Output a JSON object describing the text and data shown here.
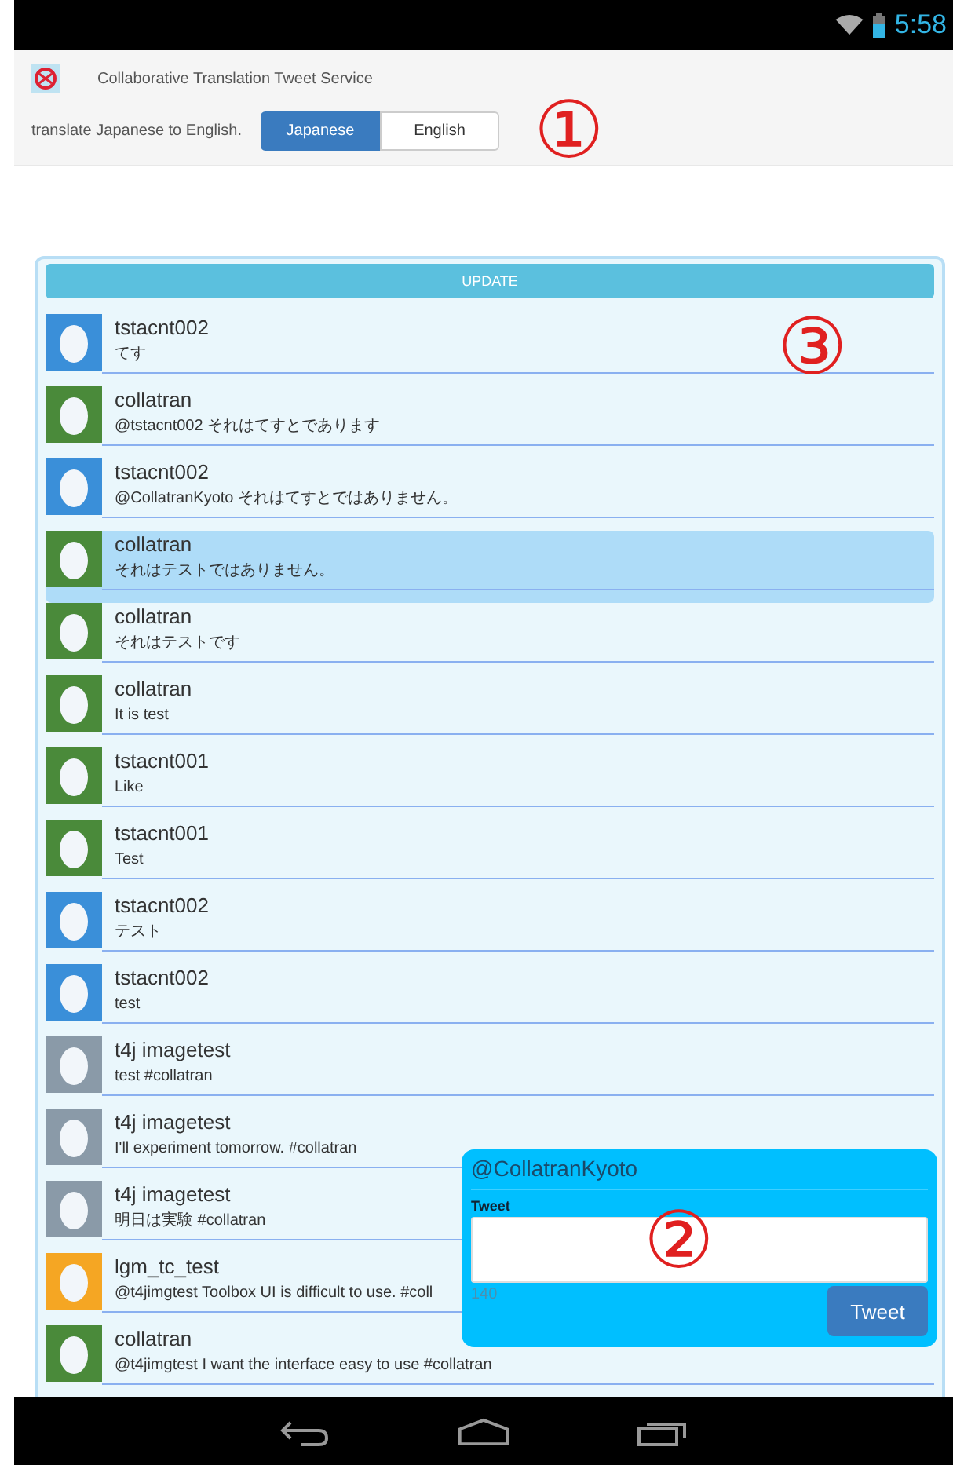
{
  "status_bar": {
    "time": "5:58"
  },
  "header": {
    "title": "Collaborative Translation Tweet Service",
    "prompt": "translate Japanese to English.",
    "languages": [
      {
        "label": "Japanese",
        "selected": true
      },
      {
        "label": "English",
        "selected": false
      }
    ]
  },
  "update_button": "UPDATE",
  "tweets": [
    {
      "user": "tstacnt002",
      "text": "てす",
      "color": "#3a8fd9",
      "selected": false
    },
    {
      "user": "collatran",
      "text": "@tstacnt002 それはてすとであります",
      "color": "#4a8a3a",
      "selected": false
    },
    {
      "user": "tstacnt002",
      "text": "@CollatranKyoto それはてすとではありません。",
      "color": "#3a8fd9",
      "selected": false
    },
    {
      "user": "collatran",
      "text": "それはテストではありません。",
      "color": "#4a8a3a",
      "selected": true
    },
    {
      "user": "collatran",
      "text": "それはテストです",
      "color": "#4a8a3a",
      "selected": false
    },
    {
      "user": "collatran",
      "text": "It is test",
      "color": "#4a8a3a",
      "selected": false
    },
    {
      "user": "tstacnt001",
      "text": "Like",
      "color": "#4a8a3a",
      "selected": false
    },
    {
      "user": "tstacnt001",
      "text": "Test",
      "color": "#4a8a3a",
      "selected": false
    },
    {
      "user": "tstacnt002",
      "text": "テスト",
      "color": "#3a8fd9",
      "selected": false
    },
    {
      "user": "tstacnt002",
      "text": "test",
      "color": "#3a8fd9",
      "selected": false
    },
    {
      "user": "t4j imagetest",
      "text": "test #collatran",
      "color": "#8a9aa8",
      "selected": false
    },
    {
      "user": "t4j imagetest",
      "text": "I'll experiment tomorrow. #collatran",
      "color": "#8a9aa8",
      "selected": false
    },
    {
      "user": "t4j imagetest",
      "text": "明日は実験 #collatran",
      "color": "#8a9aa8",
      "selected": false
    },
    {
      "user": "lgm_tc_test",
      "text": "@t4jimgtest Toolbox UI is difficult to use. #coll",
      "color": "#f5a623",
      "selected": false
    },
    {
      "user": "collatran",
      "text": "@t4jimgtest I want the interface easy to use #collatran",
      "color": "#4a8a3a",
      "selected": false
    }
  ],
  "compose": {
    "account": "@CollatranKyoto",
    "label": "Tweet",
    "counter": "140",
    "button": "Tweet"
  },
  "annotations": [
    "①",
    "②",
    "③"
  ]
}
